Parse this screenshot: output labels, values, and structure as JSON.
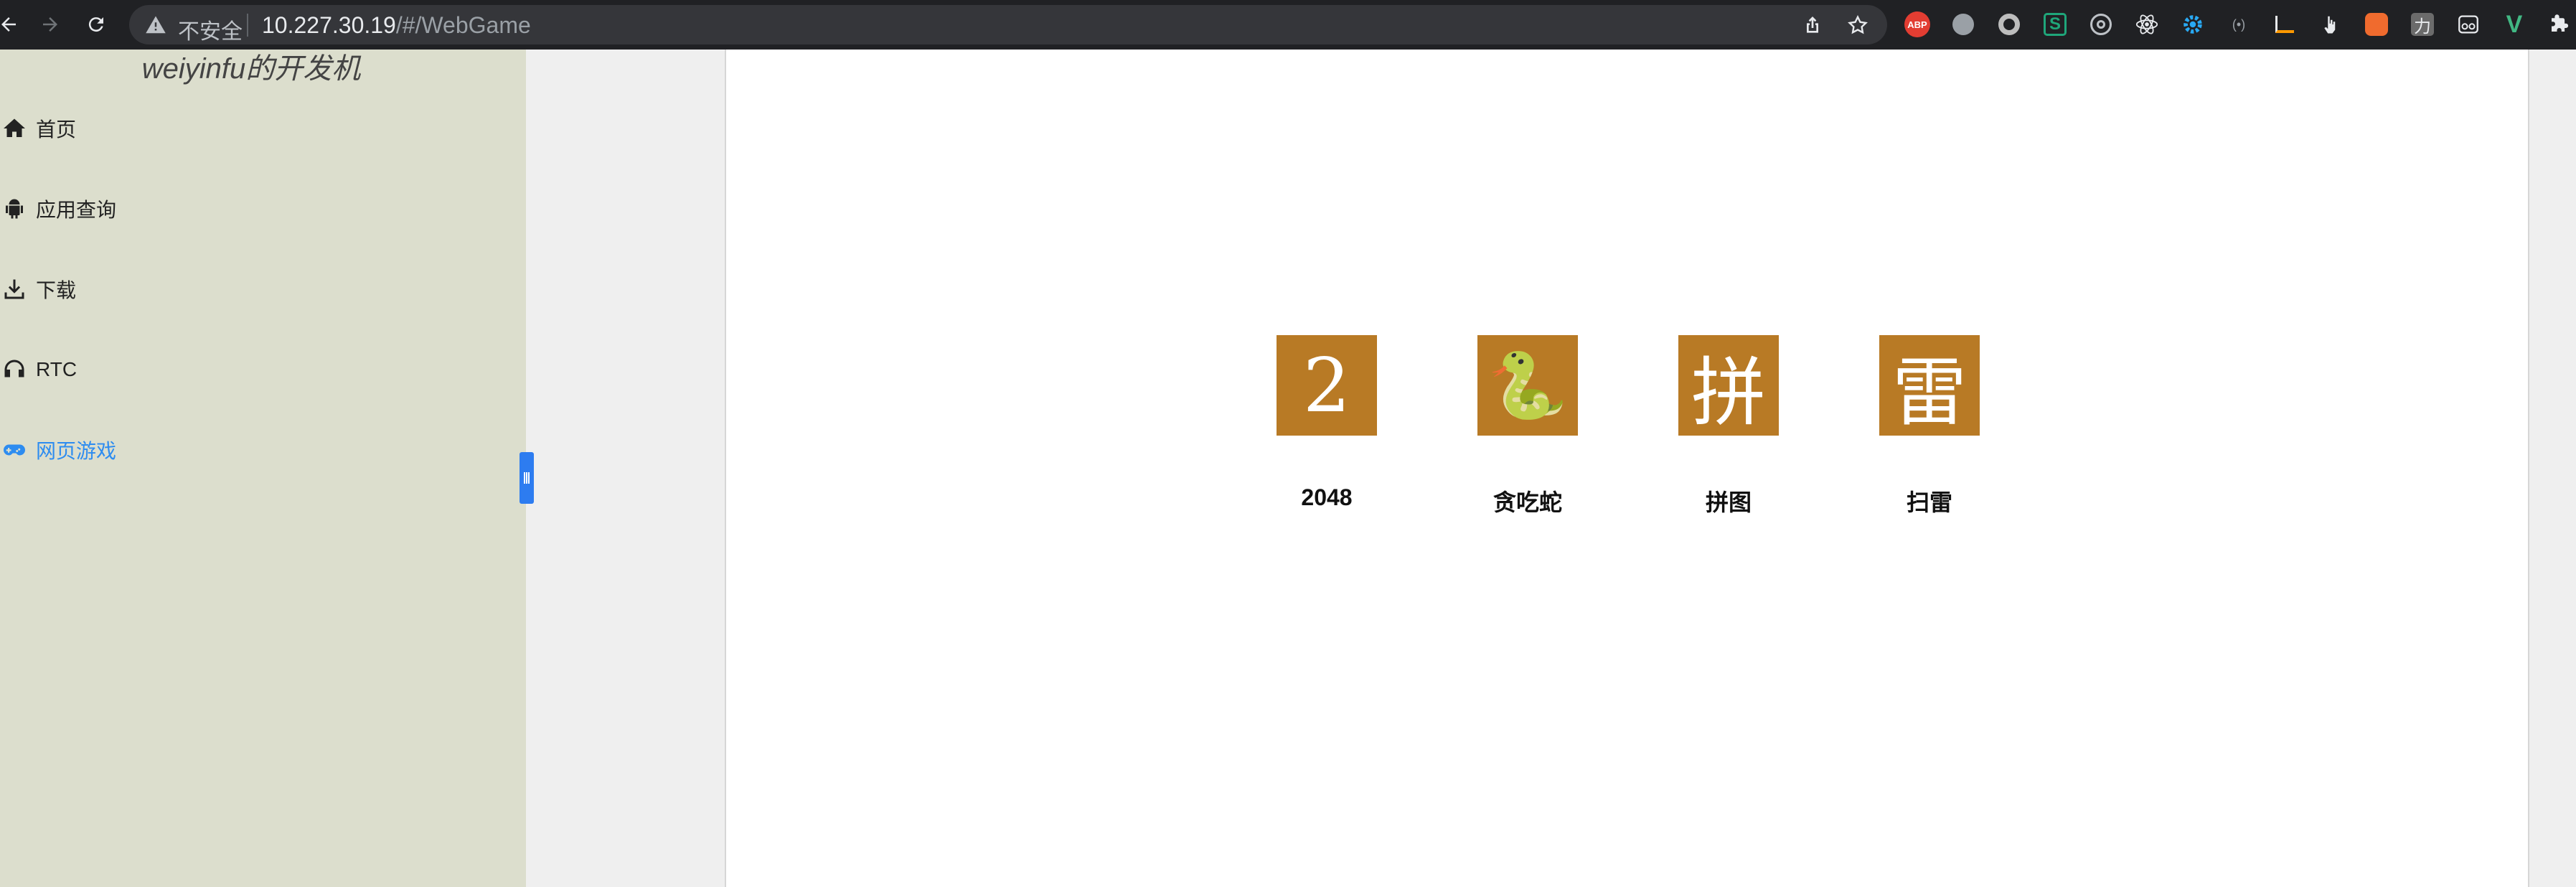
{
  "browser": {
    "insecure_label": "不安全",
    "url_host": "10.227.30.19",
    "url_path": "/#/WebGame",
    "extensions": [
      {
        "name": "adblock-plus-icon",
        "label": "ABP",
        "color": "#e23d32"
      },
      {
        "name": "clover-icon",
        "color": "#9aa0a6"
      },
      {
        "name": "record-icon",
        "color": "#bdbdbd"
      },
      {
        "name": "s-extension-icon",
        "label": "S",
        "color": "#1fa67a"
      },
      {
        "name": "target-icon",
        "color": "#bdc1c6"
      },
      {
        "name": "react-devtools-icon",
        "color": "#e8eaed"
      },
      {
        "name": "gear-extension-icon",
        "color": "#29a9f3"
      },
      {
        "name": "broadcast-icon",
        "color": "#9aa0a6"
      },
      {
        "name": "amazon-icon",
        "color": "#ff9900"
      },
      {
        "name": "pointer-icon",
        "color": "#e8eaed"
      },
      {
        "name": "orange-app-icon",
        "color": "#f06b2e"
      },
      {
        "name": "li-extension-icon",
        "label": "力",
        "color": "#6b6b6b"
      },
      {
        "name": "glasses-icon",
        "color": "#e8eaed"
      },
      {
        "name": "vue-devtools-icon",
        "label": "V",
        "color": "#41b883"
      },
      {
        "name": "puzzle-icon",
        "color": "#e8eaed"
      }
    ]
  },
  "sidebar": {
    "title": "weiyinfu的开发机",
    "items": [
      {
        "label": "首页",
        "icon": "home-icon",
        "active": false
      },
      {
        "label": "应用查询",
        "icon": "android-icon",
        "active": false
      },
      {
        "label": "下载",
        "icon": "download-icon",
        "active": false
      },
      {
        "label": "RTC",
        "icon": "headphones-icon",
        "active": false
      },
      {
        "label": "网页游戏",
        "icon": "gamepad-icon",
        "active": true
      }
    ],
    "active_color": "#2d8cf0"
  },
  "games": [
    {
      "tile": "2",
      "name": "2048"
    },
    {
      "tile": "🐍",
      "name": "贪吃蛇"
    },
    {
      "tile": "拼",
      "name": "拼图"
    },
    {
      "tile": "雷",
      "name": "扫雷"
    }
  ],
  "colors": {
    "tile_bg": "#b87a25",
    "sidebar_bg": "#dcdecd",
    "handle": "#2d7cf0"
  }
}
